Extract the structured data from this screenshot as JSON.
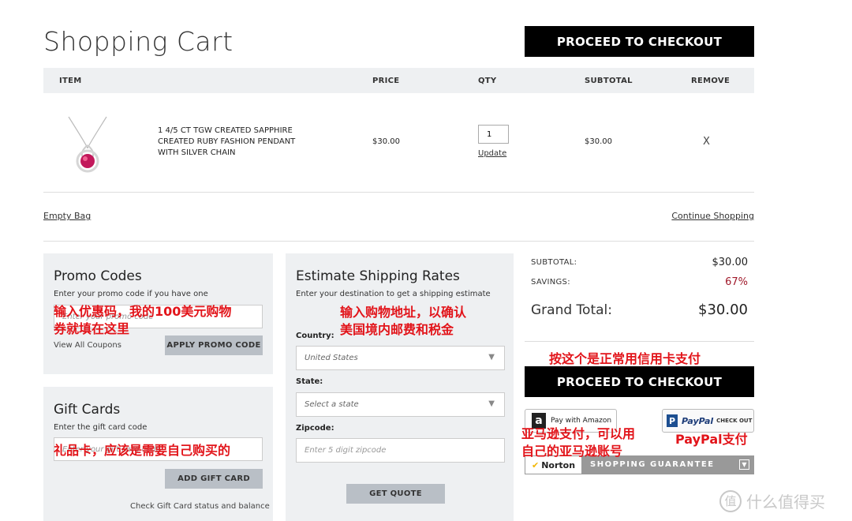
{
  "header": {
    "title": "Shopping Cart",
    "checkout_label": "PROCEED TO CHECKOUT"
  },
  "table": {
    "columns": [
      "ITEM",
      "PRICE",
      "QTY",
      "SUBTOTAL",
      "REMOVE"
    ],
    "rows": [
      {
        "name": "1 4/5 CT TGW CREATED SAPPHIRE CREATED RUBY FASHION PENDANT WITH SILVER CHAIN",
        "price": "$30.00",
        "qty": "1",
        "update_label": "Update",
        "subtotal": "$30.00",
        "remove_label": "X"
      }
    ]
  },
  "links": {
    "empty_bag": "Empty Bag",
    "continue_shopping": "Continue Shopping"
  },
  "promo": {
    "title": "Promo Codes",
    "subtitle": "Enter your promo code if you have one",
    "placeholder": "Enter your promo code",
    "view_all": "View All Coupons",
    "apply_label": "APPLY PROMO CODE"
  },
  "gift": {
    "title": "Gift Cards",
    "subtitle": "Enter the gift card code",
    "placeholder": "Enter your gift card code",
    "add_label": "ADD GIFT CARD",
    "check_label": "Check Gift Card status and balance"
  },
  "shipping": {
    "title": "Estimate Shipping Rates",
    "subtitle": "Enter your destination to get a shipping estimate",
    "country_label": "Country:",
    "country_value": "United States",
    "state_label": "State:",
    "state_value": "Select a state",
    "zip_label": "Zipcode:",
    "zip_placeholder": "Enter 5 digit zipcode",
    "quote_label": "GET QUOTE"
  },
  "summary": {
    "subtotal_label": "SUBTOTAL:",
    "subtotal_value": "$30.00",
    "savings_label": "SAVINGS:",
    "savings_value": "67%",
    "grand_label": "Grand Total:",
    "grand_value": "$30.00",
    "checkout_label": "PROCEED TO CHECKOUT",
    "amazon_label": "Pay with Amazon",
    "paypal_label": "PayPal",
    "paypal_checkout": "CHECK OUT",
    "norton_brand": "Norton",
    "norton_text": "SHOPPING GUARANTEE"
  },
  "annotations": {
    "promo_line1": "输入优惠码，我的100美元购物",
    "promo_line2": "券就填在这里",
    "ship_line1": "输入购物地址，以确认",
    "ship_line2": "美国境内邮费和税金",
    "credit": "按这个是正常用信用卡支付",
    "amazon_line1": "亚马逊支付，可以用",
    "amazon_line2": "自己的亚马逊账号",
    "paypal": "PayPal支付",
    "gift": "礼品卡，应该是需要自己购买的"
  },
  "watermark": {
    "text": "什么值得买",
    "mark": "值"
  },
  "colors": {
    "savings": "#a0192a",
    "annotation": "#e2141a",
    "panel_bg": "#eef0f2"
  }
}
